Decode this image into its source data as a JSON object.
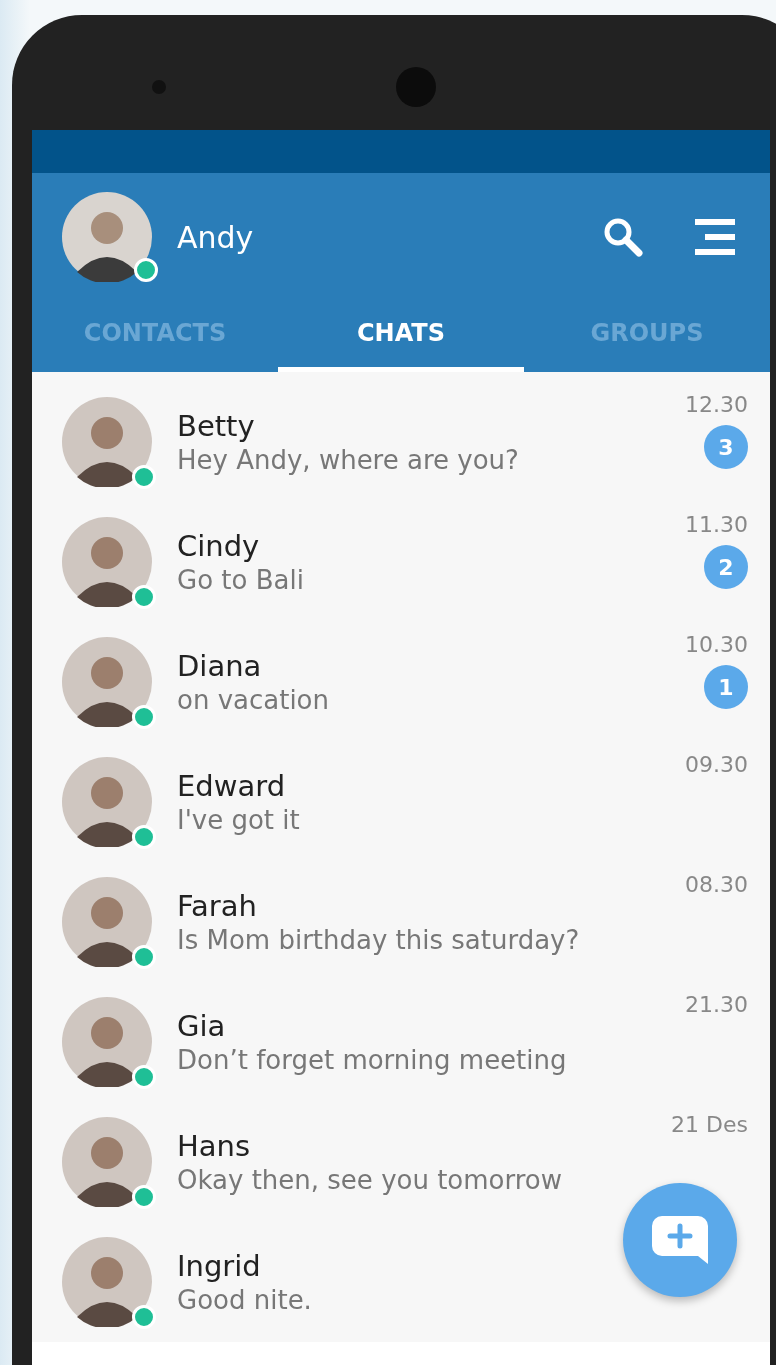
{
  "user": {
    "name": "Andy",
    "online": true
  },
  "tabs": [
    {
      "label": "CONTACTS",
      "selected": false
    },
    {
      "label": "CHATS",
      "selected": true
    },
    {
      "label": "GROUPS",
      "selected": false
    }
  ],
  "chats": [
    {
      "name": "Betty",
      "message": "Hey Andy, where are you?",
      "time": "12.30",
      "unread": "3",
      "online": true
    },
    {
      "name": "Cindy",
      "message": "Go to Bali",
      "time": "11.30",
      "unread": "2",
      "online": true
    },
    {
      "name": "Diana",
      "message": "on vacation",
      "time": "10.30",
      "unread": "1",
      "online": true
    },
    {
      "name": "Edward",
      "message": "I've got it",
      "time": "09.30",
      "online": true
    },
    {
      "name": "Farah",
      "message": "Is Mom birthday this saturday?",
      "time": "08.30",
      "online": true
    },
    {
      "name": "Gia",
      "message": "Don’t forget morning meeting",
      "time": "21.30",
      "online": true
    },
    {
      "name": "Hans",
      "message": "Okay then, see you tomorrow",
      "time": "21 Des",
      "online": true
    },
    {
      "name": "Ingrid",
      "message": "Good nite.",
      "online": true
    }
  ]
}
